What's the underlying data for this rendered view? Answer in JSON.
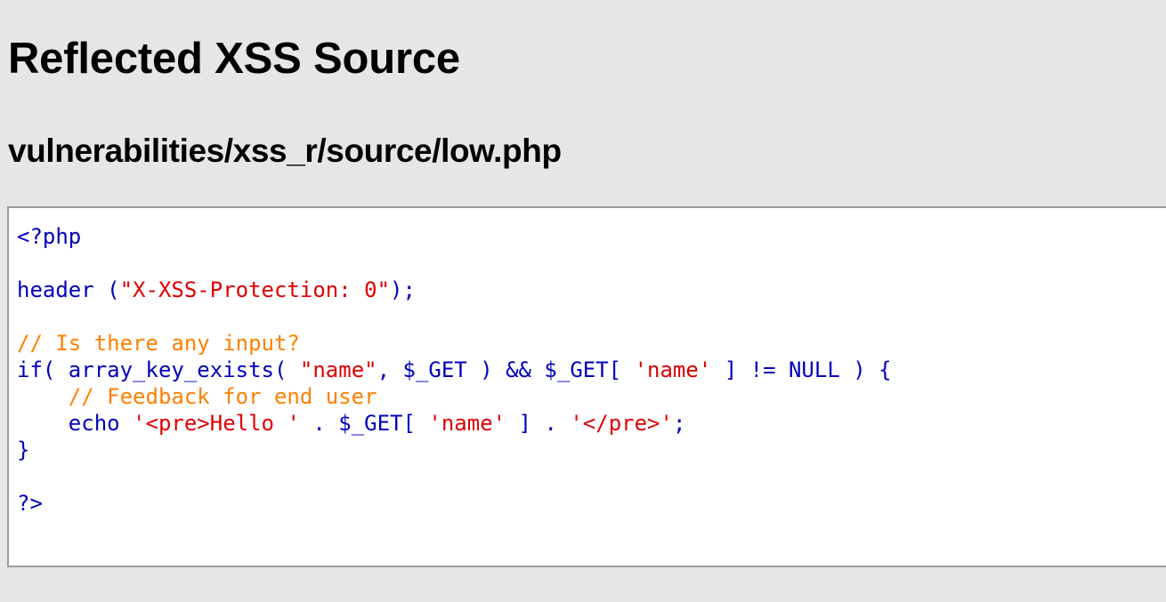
{
  "page": {
    "title": "Reflected XSS Source",
    "source_path": "vulnerabilities/xss_r/source/low.php"
  },
  "source_code": {
    "lines": [
      "<?php",
      "",
      "header (\"X-XSS-Protection: 0\");",
      "",
      "// Is there any input?",
      "if( array_key_exists( \"name\", $_GET ) && $_GET[ 'name' ] != NULL ) {",
      "    // Feedback for end user",
      "    echo '<pre>Hello ' . $_GET[ 'name' ] . '</pre>';",
      "}",
      "",
      "?>"
    ]
  },
  "colors": {
    "background": "#e6e6e6",
    "code_background": "#ffffff",
    "code_border": "#9b9b9b",
    "php_default": "#0000bb",
    "php_string": "#dd0000",
    "php_comment": "#ff8000",
    "php_keyword": "#007700"
  }
}
